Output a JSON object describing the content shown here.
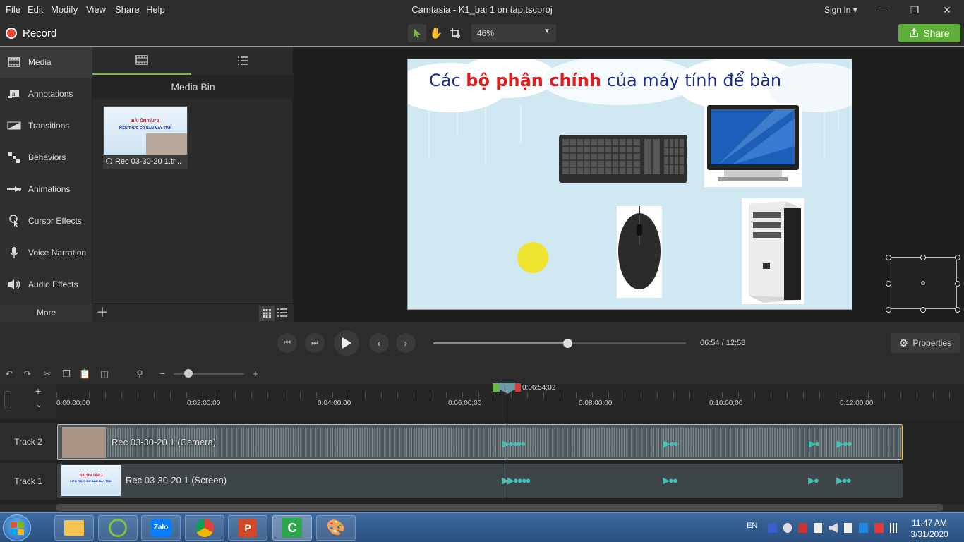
{
  "menu": [
    "File",
    "Edit",
    "Modify",
    "View",
    "Share",
    "Help"
  ],
  "app_title": "Camtasia - K1_bai 1 on tap.tscproj",
  "sign_in": "Sign In",
  "toolbar": {
    "record_label": "Record",
    "zoom": "46%",
    "share_label": "Share"
  },
  "leftnav": {
    "items": [
      {
        "label": "Media",
        "icon": "film-icon"
      },
      {
        "label": "Annotations",
        "icon": "annotation-icon"
      },
      {
        "label": "Transitions",
        "icon": "transition-icon"
      },
      {
        "label": "Behaviors",
        "icon": "behavior-icon"
      },
      {
        "label": "Animations",
        "icon": "animation-icon"
      },
      {
        "label": "Cursor Effects",
        "icon": "cursor-icon"
      },
      {
        "label": "Voice Narration",
        "icon": "microphone-icon"
      },
      {
        "label": "Audio Effects",
        "icon": "speaker-icon"
      }
    ],
    "more_label": "More"
  },
  "media_bin": {
    "title": "Media Bin",
    "item_label": "Rec 03-30-20 1.tr...",
    "thumb_title_line1": "BÀI ÔN TẬP 1",
    "thumb_title_line2": "KIẾN THỨC CƠ BẢN MÁY TÍNH"
  },
  "slide": {
    "title_a": "Các ",
    "title_b": "bộ phận chính",
    "title_c": " của máy tính để bàn"
  },
  "playback": {
    "current": "06:54",
    "separator": "/",
    "total": "12:58",
    "progress": 0.53,
    "properties_label": "Properties"
  },
  "timeline": {
    "playhead_time": "0:06:54;02",
    "ticks": [
      "0:00:00;00",
      "0:02:00;00",
      "0:04:00;00",
      "0:06:00;00",
      "0:08:00;00",
      "0:10:00;00",
      "0:12:00;00"
    ],
    "tracks": [
      {
        "name": "Track 2",
        "clip": "Rec 03-30-20 1 (Camera)"
      },
      {
        "name": "Track 1",
        "clip": "Rec 03-30-20 1 (Screen)"
      }
    ]
  },
  "taskbar": {
    "lang": "EN",
    "time": "11:47 AM",
    "date": "3/31/2020",
    "zalo": "Zalo"
  },
  "colors": {
    "accent": "#5fae3a",
    "record": "#e8453c",
    "clip_border": "#e0c040"
  }
}
